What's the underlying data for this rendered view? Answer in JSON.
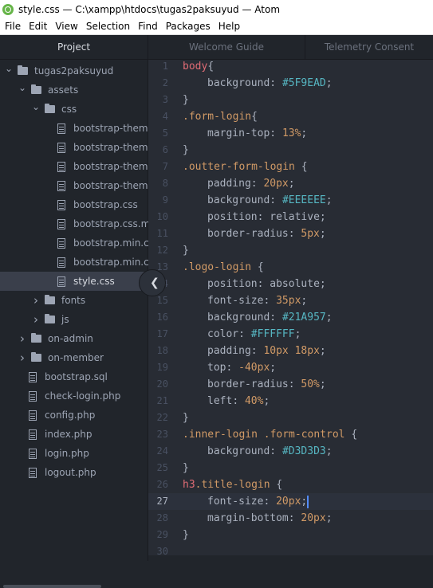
{
  "window": {
    "title": "style.css — C:\\xampp\\htdocs\\tugas2paksuyud — Atom"
  },
  "menu": [
    "File",
    "Edit",
    "View",
    "Selection",
    "Find",
    "Packages",
    "Help"
  ],
  "tree": {
    "header": "Project",
    "items": [
      {
        "label": "tugas2paksuyud",
        "type": "folder",
        "depth": 0,
        "expanded": true
      },
      {
        "label": "assets",
        "type": "folder",
        "depth": 1,
        "expanded": true
      },
      {
        "label": "css",
        "type": "folder",
        "depth": 2,
        "expanded": true
      },
      {
        "label": "bootstrap-theme",
        "type": "file",
        "depth": 3
      },
      {
        "label": "bootstrap-theme",
        "type": "file",
        "depth": 3
      },
      {
        "label": "bootstrap-theme",
        "type": "file",
        "depth": 3
      },
      {
        "label": "bootstrap-theme",
        "type": "file",
        "depth": 3
      },
      {
        "label": "bootstrap.css",
        "type": "file",
        "depth": 3
      },
      {
        "label": "bootstrap.css.ma",
        "type": "file",
        "depth": 3
      },
      {
        "label": "bootstrap.min.css",
        "type": "file",
        "depth": 3
      },
      {
        "label": "bootstrap.min.css",
        "type": "file",
        "depth": 3
      },
      {
        "label": "style.css",
        "type": "file",
        "depth": 3,
        "selected": true
      },
      {
        "label": "fonts",
        "type": "folder",
        "depth": 2,
        "expanded": false
      },
      {
        "label": "js",
        "type": "folder",
        "depth": 2,
        "expanded": false
      },
      {
        "label": "on-admin",
        "type": "folder",
        "depth": 1,
        "expanded": false
      },
      {
        "label": "on-member",
        "type": "folder",
        "depth": 1,
        "expanded": false
      },
      {
        "label": "bootstrap.sql",
        "type": "file",
        "depth": 1
      },
      {
        "label": "check-login.php",
        "type": "file",
        "depth": 1
      },
      {
        "label": "config.php",
        "type": "file",
        "depth": 1
      },
      {
        "label": "index.php",
        "type": "file",
        "depth": 1
      },
      {
        "label": "login.php",
        "type": "file",
        "depth": 1
      },
      {
        "label": "logout.php",
        "type": "file",
        "depth": 1
      }
    ]
  },
  "tabs": [
    "Welcome Guide",
    "Telemetry Consent"
  ],
  "editor": {
    "cursor_line": 27,
    "lines": [
      {
        "n": "1",
        "text": "body{"
      },
      {
        "n": "2",
        "text": "    background: #5F9EAD;"
      },
      {
        "n": "3",
        "text": "}"
      },
      {
        "n": "4",
        "text": ".form-login{"
      },
      {
        "n": "5",
        "text": "    margin-top: 13%;"
      },
      {
        "n": "6",
        "text": "}"
      },
      {
        "n": "7",
        "text": ".outter-form-login {"
      },
      {
        "n": "8",
        "text": "    padding: 20px;"
      },
      {
        "n": "9",
        "text": "    background: #EEEEEE;"
      },
      {
        "n": "10",
        "text": "    position: relative;"
      },
      {
        "n": "11",
        "text": "    border-radius: 5px;"
      },
      {
        "n": "12",
        "text": "}"
      },
      {
        "n": "13",
        "text": ".logo-login {"
      },
      {
        "n": "14",
        "text": "    position: absolute;"
      },
      {
        "n": "15",
        "text": "    font-size: 35px;"
      },
      {
        "n": "16",
        "text": "    background: #21A957;"
      },
      {
        "n": "17",
        "text": "    color: #FFFFFF;"
      },
      {
        "n": "18",
        "text": "    padding: 10px 18px;"
      },
      {
        "n": "19",
        "text": "    top: -40px;"
      },
      {
        "n": "20",
        "text": "    border-radius: 50%;"
      },
      {
        "n": "21",
        "text": "    left: 40%;"
      },
      {
        "n": "22",
        "text": "}"
      },
      {
        "n": "23",
        "text": ".inner-login .form-control {"
      },
      {
        "n": "24",
        "text": "    background: #D3D3D3;"
      },
      {
        "n": "25",
        "text": "}"
      },
      {
        "n": "26",
        "text": "h3.title-login {"
      },
      {
        "n": "27",
        "text": "    font-size: 20px;"
      },
      {
        "n": "28",
        "text": "    margin-bottom: 20px;"
      },
      {
        "n": "29",
        "text": "}"
      },
      {
        "n": "30",
        "text": ""
      }
    ]
  },
  "colors": {
    "background": "#21252b",
    "editor_bg": "#282c34",
    "selector": "#e06c75",
    "number": "#d19a66",
    "color_literal": "#56b6c2"
  }
}
